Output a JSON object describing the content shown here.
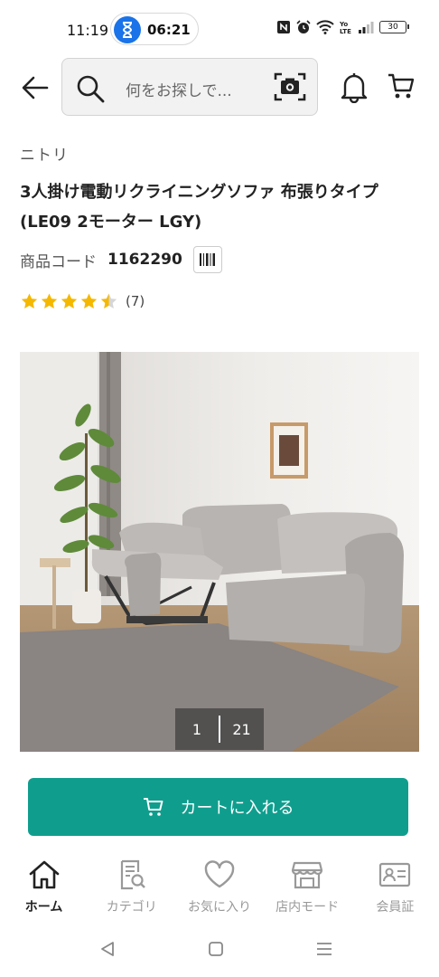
{
  "status_bar": {
    "time": "11:19",
    "timer": "06:21",
    "battery": "30",
    "icons": [
      "nfc-icon",
      "alarm-icon",
      "wifi-icon",
      "volte-icon",
      "signal-icon",
      "battery-icon"
    ]
  },
  "header": {
    "search_placeholder": "何をお探しで...",
    "icons": [
      "back-arrow-icon",
      "search-icon",
      "camera-icon",
      "bell-icon",
      "cart-icon"
    ]
  },
  "product": {
    "brand": "ニトリ",
    "title": "3人掛け電動リクライニングソファ 布張りタイプ (LE09 2モーター LGY)",
    "code_label": "商品コード",
    "code_value": "1162290",
    "rating": 4.5,
    "review_count": "(7)"
  },
  "gallery": {
    "current": "1",
    "total": "21"
  },
  "cart_button": {
    "label": "カートに入れる"
  },
  "bottom_nav": {
    "items": [
      {
        "label": "ホーム",
        "icon": "home-icon",
        "active": true
      },
      {
        "label": "カテゴリ",
        "icon": "category-search-icon",
        "active": false
      },
      {
        "label": "お気に入り",
        "icon": "heart-icon",
        "active": false
      },
      {
        "label": "店内モード",
        "icon": "store-icon",
        "active": false
      },
      {
        "label": "会員証",
        "icon": "member-card-icon",
        "active": false
      }
    ]
  },
  "colors": {
    "accent": "#0f9e8e",
    "star": "#f5b800",
    "timer_blue": "#1a73e8"
  }
}
